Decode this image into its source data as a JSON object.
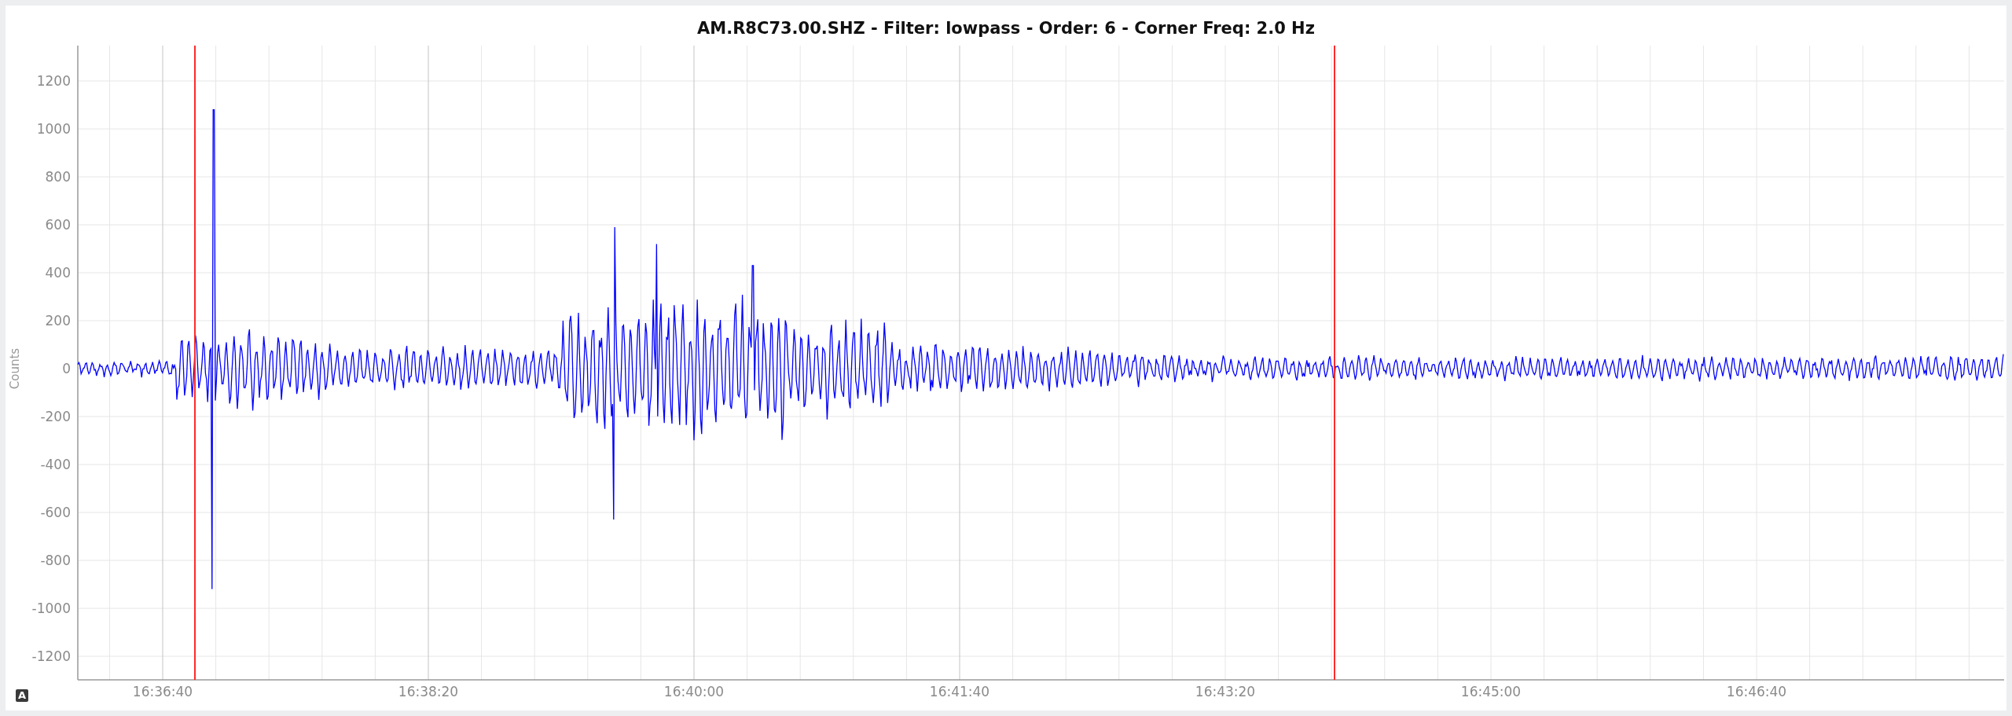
{
  "chart": {
    "title": "AM.R8C73.00.SHZ - Filter: lowpass - Order: 6 - Corner Freq: 2.0 Hz",
    "y_axis": {
      "label": "Counts",
      "ticks": [
        "1200",
        "1000",
        "800",
        "600",
        "400",
        "200",
        "0",
        "-200",
        "-400",
        "-600",
        "-800",
        "-1000",
        "-1200"
      ]
    },
    "x_axis": {
      "ticks": [
        "16:36:40",
        "16:38:20",
        "16:40:00",
        "16:41:40",
        "16:43:20",
        "16:45:00",
        "16:46:40"
      ]
    }
  },
  "corner_badge": "A"
}
